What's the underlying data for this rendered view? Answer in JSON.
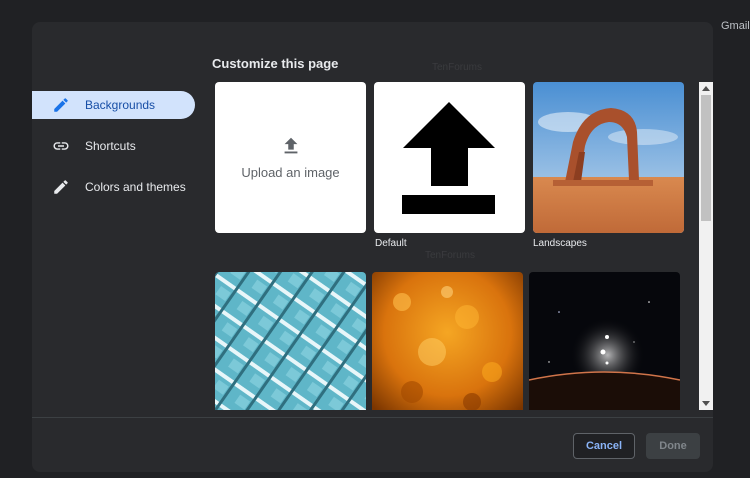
{
  "top_link": "Gmail",
  "dialog": {
    "title": "Customize this page",
    "watermark": "TenForums"
  },
  "sidebar": {
    "items": [
      {
        "label": "Backgrounds",
        "icon": "pencil-icon",
        "active": true
      },
      {
        "label": "Shortcuts",
        "icon": "link-icon",
        "active": false
      },
      {
        "label": "Colors and themes",
        "icon": "pencil-icon",
        "active": false
      }
    ]
  },
  "tiles": {
    "upload_label": "Upload an image",
    "default_label": "Default",
    "landscapes_label": "Landscapes"
  },
  "footer": {
    "cancel_label": "Cancel",
    "done_label": "Done"
  },
  "colors": {
    "accent": "#8ab4f8",
    "active_item_bg": "#d2e3fc",
    "dialog_bg": "#292a2d"
  }
}
